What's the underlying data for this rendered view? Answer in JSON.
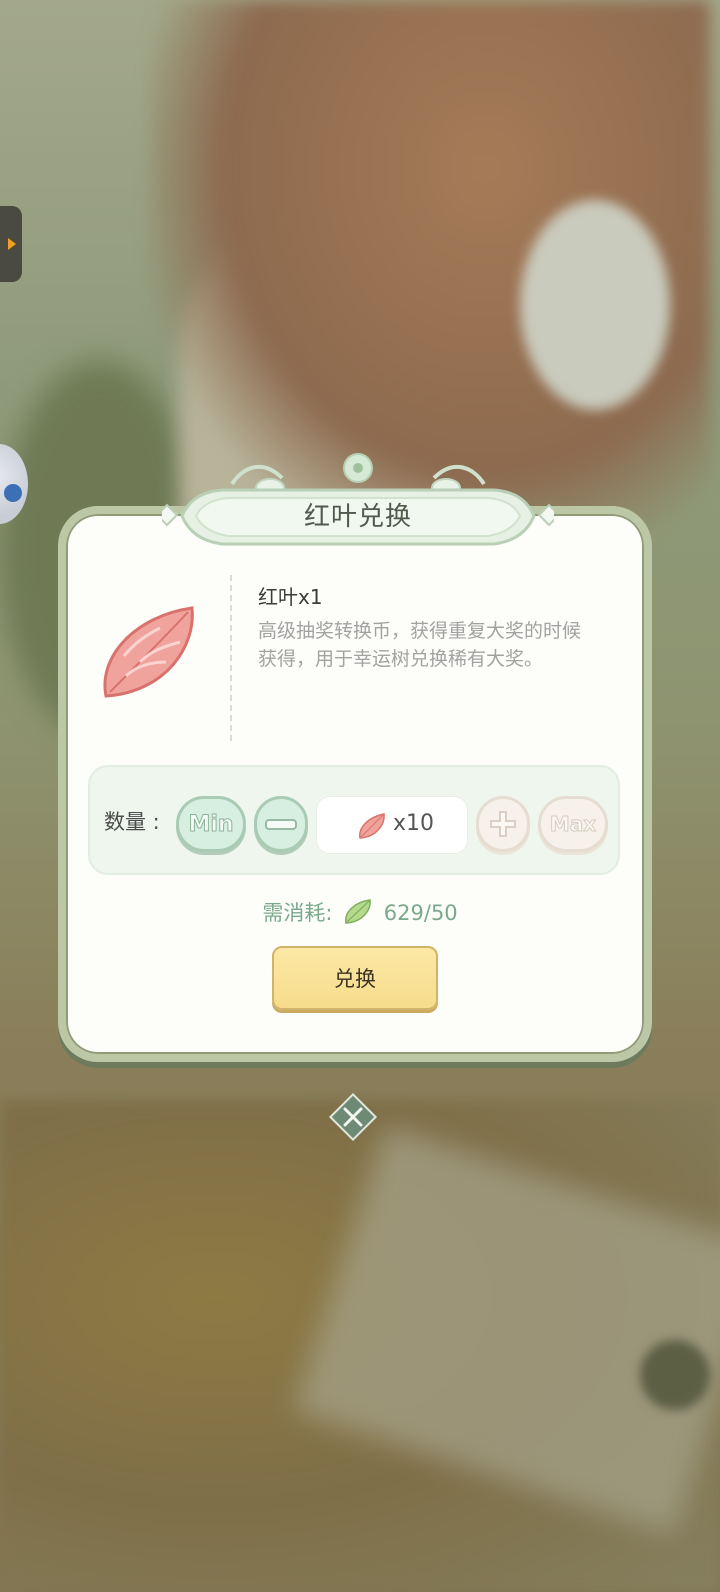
{
  "dialog": {
    "title": "红叶兑换",
    "item": {
      "name": "红叶x1",
      "description": "高级抽奖转换币，获得重复大奖的时候获得，用于幸运树兑换稀有大奖。",
      "icon": "red-leaf-icon"
    },
    "quantity": {
      "label": "数量 :",
      "min_label": "Min",
      "max_label": "Max",
      "value": "x10"
    },
    "cost": {
      "label": "需消耗:",
      "icon": "green-leaf-icon",
      "value": "629/50"
    },
    "exchange_label": "兑换",
    "close_icon": "close-icon"
  },
  "colors": {
    "accent_green": "#7aa98c",
    "button_yellow": "#f6dc8c",
    "leaf_red": "#e98c86"
  }
}
